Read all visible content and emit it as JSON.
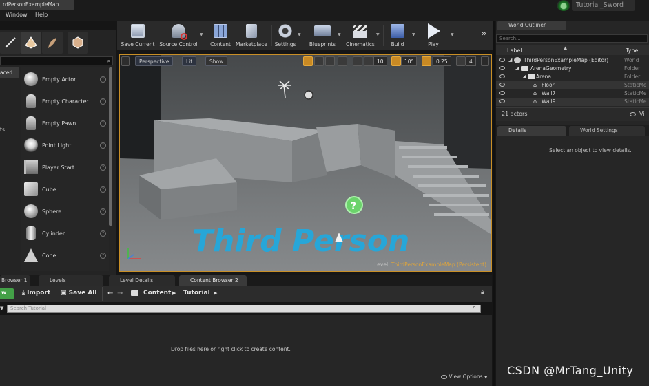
{
  "window": {
    "tab_title": "rdPersonExampleMap",
    "project_name": "Tutorial_Sword"
  },
  "menu": [
    "Window",
    "Help"
  ],
  "modes": {
    "search_placeholder": "",
    "categories": [
      "aced",
      "ts"
    ],
    "items": [
      {
        "label": "Empty Actor",
        "icon": "empty-actor-icon"
      },
      {
        "label": "Empty Character",
        "icon": "character-icon"
      },
      {
        "label": "Empty Pawn",
        "icon": "pawn-icon"
      },
      {
        "label": "Point Light",
        "icon": "point-light-icon"
      },
      {
        "label": "Player Start",
        "icon": "player-start-icon"
      },
      {
        "label": "Cube",
        "icon": "cube-icon"
      },
      {
        "label": "Sphere",
        "icon": "sphere-icon"
      },
      {
        "label": "Cylinder",
        "icon": "cylinder-icon"
      },
      {
        "label": "Cone",
        "icon": "cone-icon"
      }
    ],
    "help": "?"
  },
  "toolbar": {
    "buttons": [
      {
        "label": "Save Current",
        "icon": "save-icon"
      },
      {
        "label": "Source Control",
        "icon": "source-control-icon"
      },
      {
        "label": "Content",
        "icon": "content-icon"
      },
      {
        "label": "Marketplace",
        "icon": "marketplace-icon"
      },
      {
        "label": "Settings",
        "icon": "settings-icon"
      },
      {
        "label": "Blueprints",
        "icon": "blueprints-icon"
      },
      {
        "label": "Cinematics",
        "icon": "cinematics-icon"
      },
      {
        "label": "Build",
        "icon": "build-icon"
      },
      {
        "label": "Play",
        "icon": "play-icon"
      }
    ],
    "overflow": "»"
  },
  "viewport": {
    "perspective": "Perspective",
    "lit": "Lit",
    "show": "Show",
    "grid_snap": "10",
    "rotation_snap": "10°",
    "scale_snap": "0.25",
    "camera_speed": "4",
    "scene_text": "Third Person",
    "level_label": "Level:",
    "level_name": "ThirdPersonExampleMap (Persistent)",
    "accent": "#c98f26"
  },
  "outliner": {
    "tab": "World Outliner",
    "search_placeholder": "Search...",
    "col_label": "Label",
    "col_type": "Type",
    "rows": [
      {
        "label": "ThirdPersonExampleMap (Editor)",
        "type": "World"
      },
      {
        "label": "ArenaGeometry",
        "type": "Folder"
      },
      {
        "label": "Arena",
        "type": "Folder"
      },
      {
        "label": "Floor",
        "type": "StaticMe"
      },
      {
        "label": "Wall7",
        "type": "StaticMe"
      },
      {
        "label": "Wall9",
        "type": "StaticMe"
      }
    ],
    "count": "21 actors",
    "view_label": "Vi"
  },
  "details": {
    "tab_details": "Details",
    "tab_world": "World Settings",
    "empty_message": "Select an object to view details."
  },
  "content_browser": {
    "tabs": [
      "Browser 1",
      "Levels",
      "Level Details",
      "Content Browser 2"
    ],
    "add_label": "w",
    "import_label": "Import",
    "save_all_label": "Save All",
    "path": [
      "Content",
      "Tutorial"
    ],
    "search_placeholder": "Search Tutorial",
    "empty_message": "Drop files here or right click to create content.",
    "view_options": "View Options"
  },
  "watermark": "CSDN @MrTang_Unity"
}
